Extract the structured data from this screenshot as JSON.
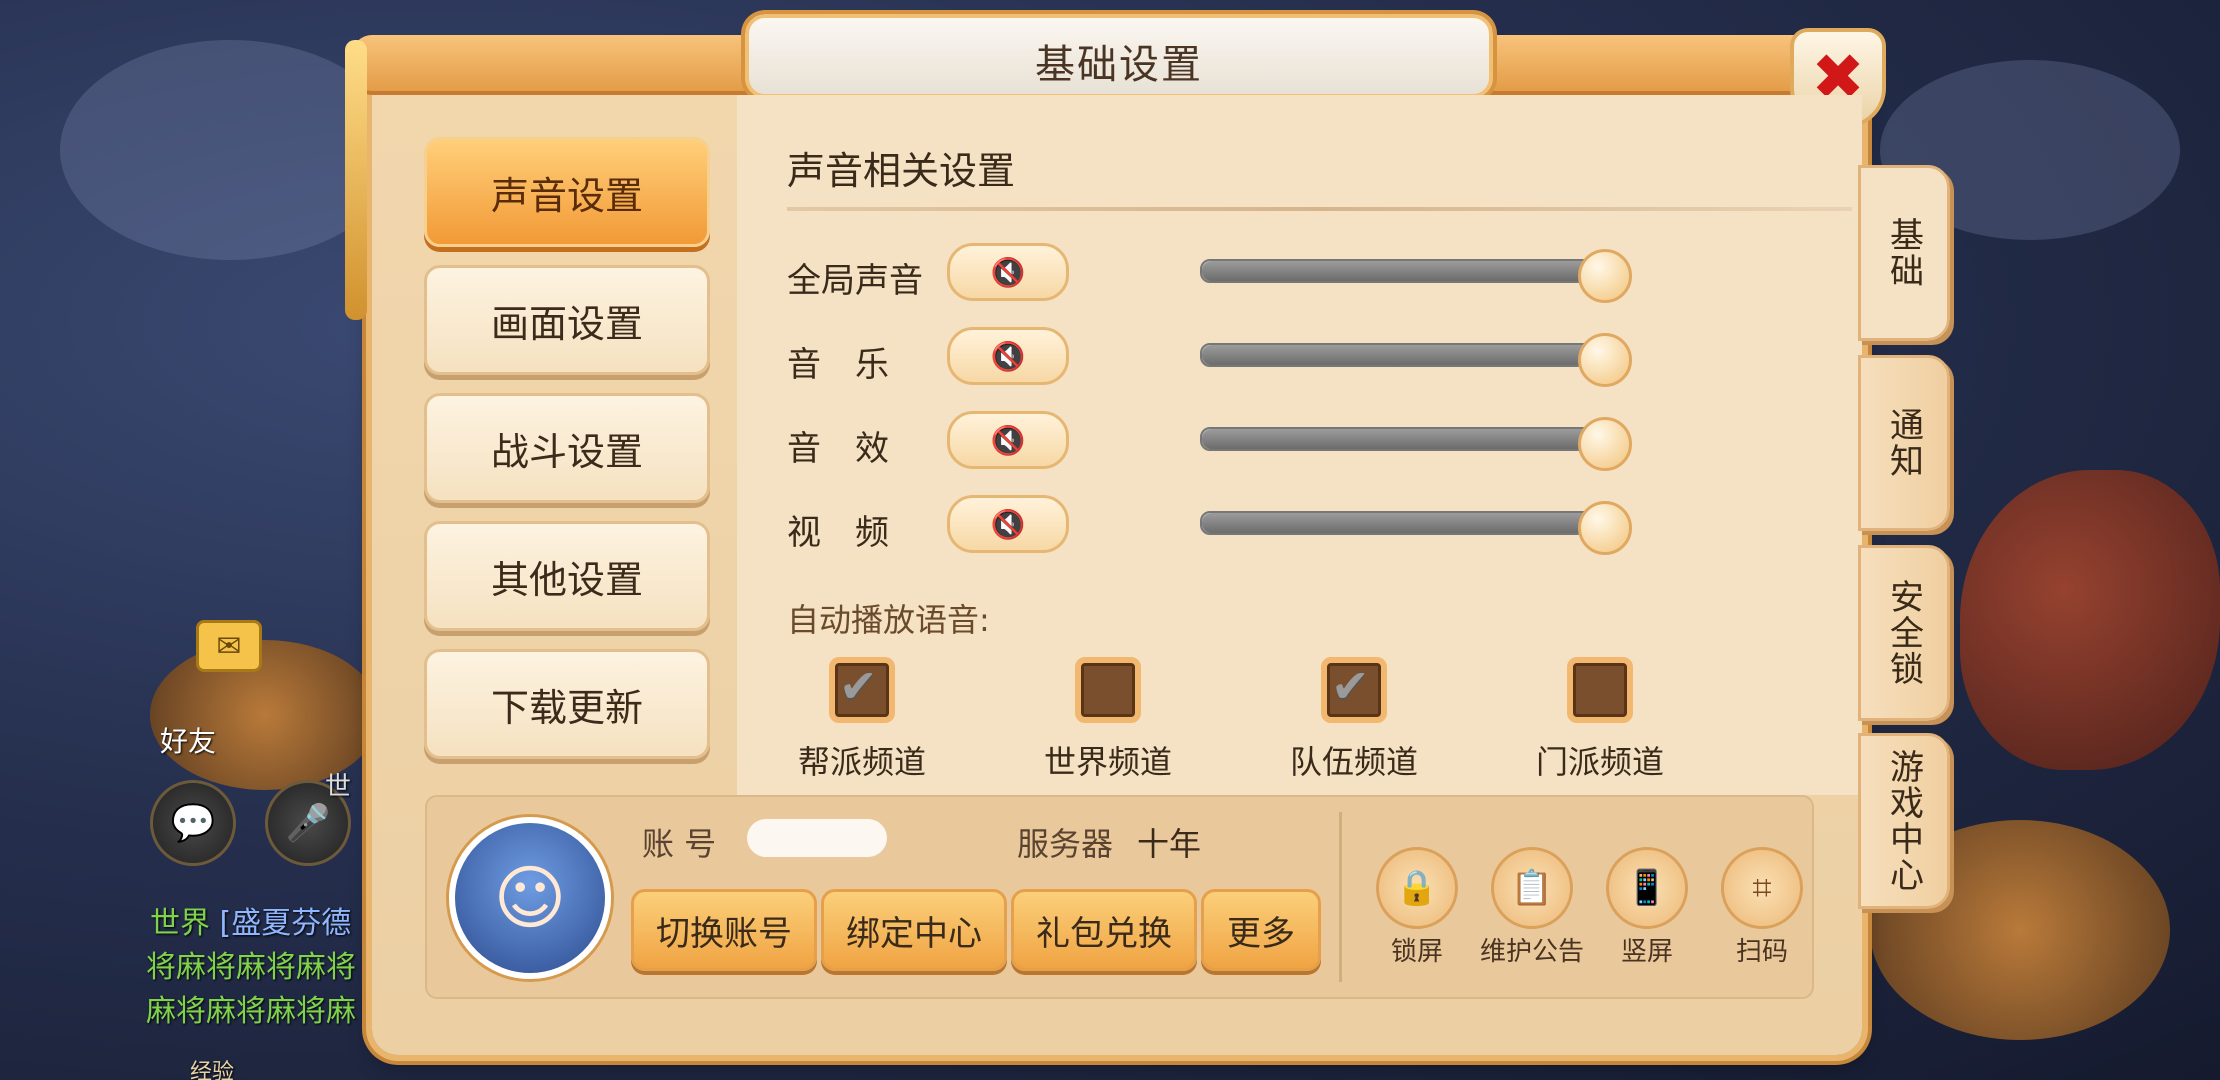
{
  "window": {
    "title": "基础设置"
  },
  "left_menu": [
    {
      "label": "声音设置",
      "active": true
    },
    {
      "label": "画面设置",
      "active": false
    },
    {
      "label": "战斗设置",
      "active": false
    },
    {
      "label": "其他设置",
      "active": false
    },
    {
      "label": "下载更新",
      "active": false
    }
  ],
  "sound": {
    "section_title": "声音相关设置",
    "rows": [
      {
        "label": "全局声音",
        "mute_icon": "speaker-muted-icon",
        "level": 1.0
      },
      {
        "label": "音　乐",
        "mute_icon": "speaker-muted-icon",
        "level": 1.0
      },
      {
        "label": "音　效",
        "mute_icon": "speaker-muted-icon",
        "level": 1.0
      },
      {
        "label": "视　频",
        "mute_icon": "speaker-muted-icon",
        "level": 1.0
      }
    ],
    "auto_play_label": "自动播放语音:",
    "channels": [
      {
        "label": "帮派频道",
        "checked": true
      },
      {
        "label": "世界频道",
        "checked": false
      },
      {
        "label": "队伍频道",
        "checked": true
      },
      {
        "label": "门派频道",
        "checked": false
      }
    ]
  },
  "account": {
    "account_label": "账 号",
    "account_value": "",
    "server_label": "服务器",
    "server_value": "十年",
    "buttons": [
      "切换账号",
      "绑定中心",
      "礼包兑换",
      "更多"
    ],
    "icon_buttons": [
      {
        "label": "锁屏",
        "icon": "lock-icon"
      },
      {
        "label": "维护公告",
        "icon": "clipboard-icon"
      },
      {
        "label": "竖屏",
        "icon": "rotate-screen-icon"
      },
      {
        "label": "扫码",
        "icon": "scan-icon"
      }
    ]
  },
  "right_tabs": [
    {
      "label": "基础",
      "active": true
    },
    {
      "label": "通知",
      "active": false
    },
    {
      "label": "安全锁",
      "active": false
    },
    {
      "label": "游戏中心",
      "active": false
    }
  ],
  "background": {
    "friend_label": "好友",
    "chat_channel": "世界",
    "chat_text_1": "[盛夏芬德",
    "chat_text_2": "将麻将麻将麻将",
    "chat_text_3": "麻将麻将麻将麻",
    "exp_label": "经验",
    "world_short": "世"
  },
  "colors": {
    "accent": "#f29a36",
    "close": "#d11717",
    "panel": "#f2d6ad",
    "chat_green": "#7fd34b"
  }
}
